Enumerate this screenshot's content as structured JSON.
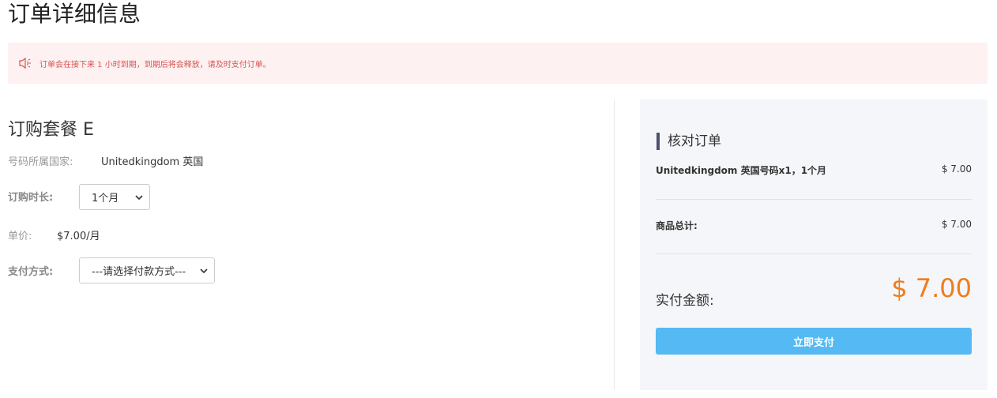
{
  "page": {
    "title": "订单详细信息"
  },
  "alert": {
    "icon": "speaker-icon",
    "message": "订单会在接下来 1 小时到期，到期后将会释放，请及时支付订单。"
  },
  "package": {
    "title": "订购套餐 E",
    "country_label": "号码所属国家:",
    "country_value": "Unitedkingdom 英国",
    "duration_label": "订购时长:",
    "duration_selected": "1个月",
    "unit_price_label": "单价:",
    "unit_price_value": "$7.00/月",
    "payment_label": "支付方式:",
    "payment_selected": "---请选择付款方式---"
  },
  "summary": {
    "title": "核对订单",
    "item_name": "Unitedkingdom 英国号码x1，1个月",
    "item_price": "$ 7.00",
    "subtotal_label": "商品总计:",
    "subtotal_value": "$ 7.00",
    "total_label": "实付金额:",
    "total_value": "$ 7.00",
    "pay_button": "立即支付"
  },
  "colors": {
    "alert_bg": "#fdf1f1",
    "alert_text": "#d9534f",
    "accent_orange": "#f07c1b",
    "pay_button": "#55b9f3",
    "title_bar": "#4a5170"
  }
}
